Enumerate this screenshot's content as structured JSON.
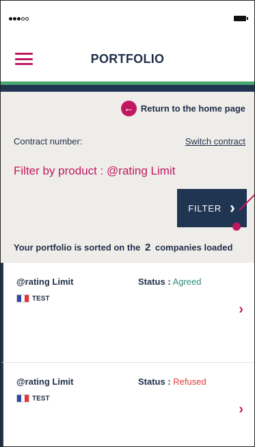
{
  "header": {
    "title": "PORTFOLIO"
  },
  "panel": {
    "home_link": "Return to the home page",
    "contract_label": "Contract number:",
    "switch_contract": "Switch contract",
    "filter_title": "Filter by product : @rating Limit",
    "filter_button": "FILTER",
    "sorted_prefix": "Your portfolio is sorted on the",
    "sorted_count": "2",
    "sorted_suffix": "companies loaded"
  },
  "items": [
    {
      "product": "@rating Limit",
      "status_label": "Status :",
      "status_value": "Agreed",
      "status_color": "#2a8c7a",
      "company": "TEST"
    },
    {
      "product": "@rating Limit",
      "status_label": "Status :",
      "status_value": "Refused",
      "status_color": "#e53935",
      "company": "TEST"
    }
  ],
  "colors": {
    "accent": "#c0185f",
    "navy": "#1f3552",
    "green_bar": "#4aa76f",
    "panel_bg": "#efedea"
  },
  "icons": {
    "menu": "hamburger-icon",
    "home": "circle-arrow-left-icon",
    "filter": "chevron-right-icon",
    "row": "chevron-right-icon",
    "flag": "french-flag-icon"
  }
}
